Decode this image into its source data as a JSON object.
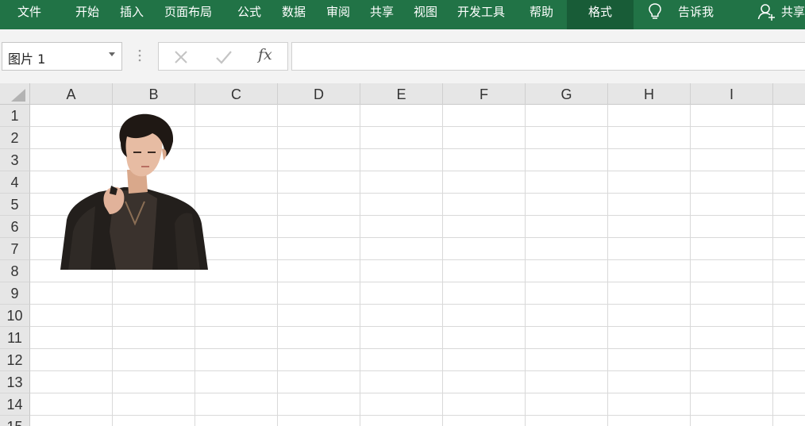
{
  "ribbon": {
    "tabs": [
      {
        "label": "文件"
      },
      {
        "label": "开始"
      },
      {
        "label": "插入"
      },
      {
        "label": "页面布局"
      },
      {
        "label": "公式"
      },
      {
        "label": "数据"
      },
      {
        "label": "审阅"
      },
      {
        "label": "共享"
      },
      {
        "label": "视图"
      },
      {
        "label": "开发工具"
      },
      {
        "label": "帮助"
      },
      {
        "label": "格式",
        "active": true
      }
    ],
    "tell_me": {
      "label": "告诉我",
      "icon": "lightbulb-icon"
    },
    "share": {
      "label": "共享",
      "icon": "person-add-icon"
    },
    "colors": {
      "ribbon_bg": "#217346",
      "active_tab_bg": "#185c37",
      "text": "#ffffff"
    }
  },
  "formula_bar": {
    "name_box": {
      "value": "图片 1"
    },
    "fx_label": "fx",
    "formula_value": ""
  },
  "grid": {
    "columns": [
      "A",
      "B",
      "C",
      "D",
      "E",
      "F",
      "G",
      "H",
      "I"
    ],
    "rows": [
      "1",
      "2",
      "3",
      "4",
      "5",
      "6",
      "7",
      "8",
      "9",
      "10",
      "11",
      "12",
      "13",
      "14",
      "15"
    ],
    "colors": {
      "header_bg": "#e6e6e6",
      "gridline": "#d9d9d9"
    }
  },
  "picture": {
    "name": "图片 1",
    "depicts": "young man in dark jacket"
  }
}
